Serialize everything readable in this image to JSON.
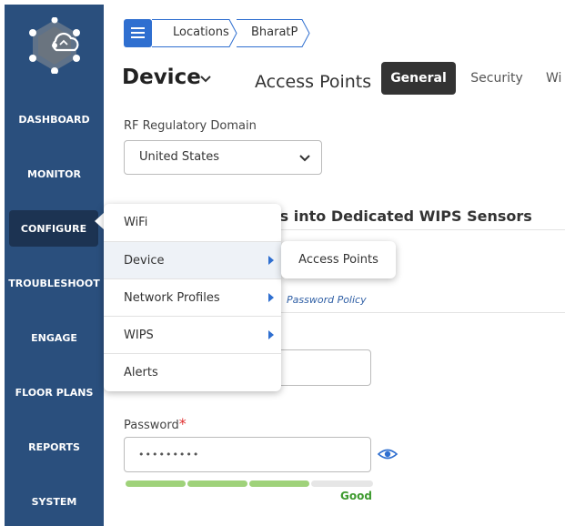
{
  "sidebar": {
    "items": [
      {
        "label": "DASHBOARD"
      },
      {
        "label": "MONITOR"
      },
      {
        "label": "CONFIGURE"
      },
      {
        "label": "TROUBLESHOOT"
      },
      {
        "label": "ENGAGE"
      },
      {
        "label": "FLOOR PLANS"
      },
      {
        "label": "REPORTS"
      },
      {
        "label": "SYSTEM"
      }
    ],
    "active": "CONFIGURE"
  },
  "breadcrumb": {
    "items": [
      "Locations",
      "BharatP"
    ]
  },
  "header": {
    "title": "Device",
    "subtitle": "Access Points",
    "tabs": [
      {
        "label": "General",
        "active": true
      },
      {
        "label": "Security",
        "active": false
      },
      {
        "label": "Wi",
        "active": false
      }
    ]
  },
  "form": {
    "rf_domain_label": "RF Regulatory Domain",
    "rf_domain_value": "United States",
    "section_title": "ts into Dedicated WIPS Sensors",
    "password_policy_link": "Password Policy",
    "password_label": "Password",
    "password_required_mark": "*",
    "password_value": "•••••••••",
    "strength_label": "Good",
    "strength_level": 0.75,
    "strength_color": "#9fd27a"
  },
  "configure_menu": {
    "items": [
      {
        "label": "WiFi",
        "has_submenu": false
      },
      {
        "label": "Device",
        "has_submenu": true
      },
      {
        "label": "Network Profiles",
        "has_submenu": true
      },
      {
        "label": "WIPS",
        "has_submenu": true
      },
      {
        "label": "Alerts",
        "has_submenu": false
      }
    ],
    "highlighted": "Device",
    "submenu": {
      "items": [
        "Access Points"
      ]
    }
  },
  "colors": {
    "sidebar_bg": "#2a4f7d",
    "sidebar_active": "#1c3352",
    "accent": "#2f6fd0",
    "tab_active_bg": "#333333",
    "required": "#e03030",
    "good": "#3d9a2e"
  }
}
